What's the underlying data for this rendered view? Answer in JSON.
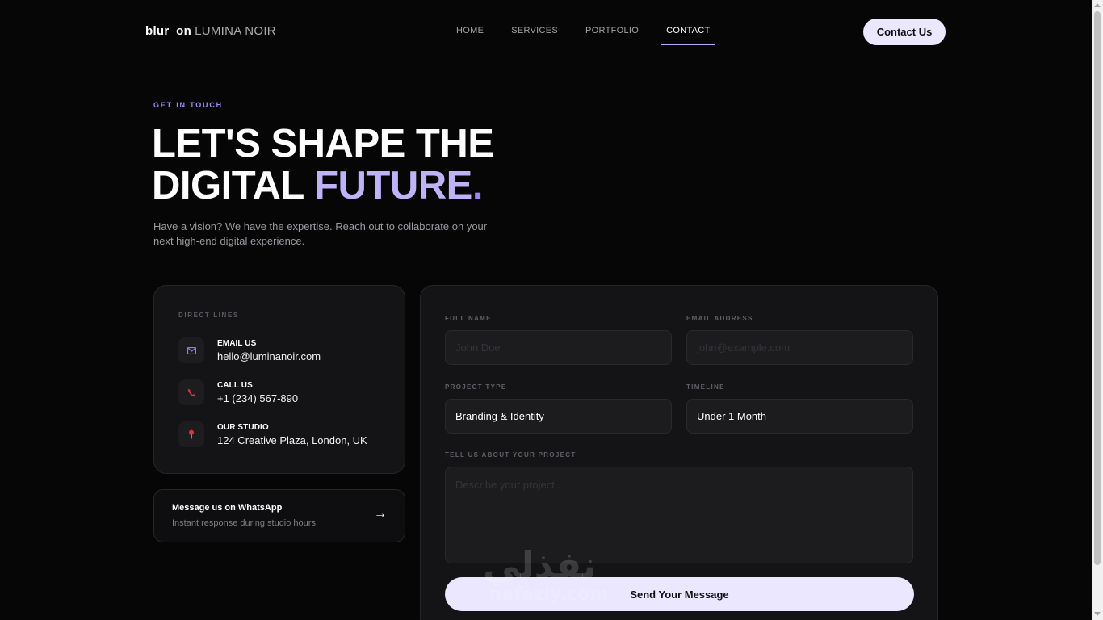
{
  "header": {
    "logo_mark": "blur_on",
    "logo_name": "LUMINA NOIR",
    "nav": [
      {
        "label": "HOME"
      },
      {
        "label": "SERVICES"
      },
      {
        "label": "PORTFOLIO"
      },
      {
        "label": "CONTACT",
        "active": true
      }
    ],
    "cta_label": "Contact Us"
  },
  "hero": {
    "eyebrow": "GET IN TOUCH",
    "headline_line1": "LET'S SHAPE THE",
    "headline_line2_plain": "DIGITAL",
    "headline_line2_accent": "FUTURE",
    "headline_dot": ".",
    "intro": "Have a vision? We have the expertise. Reach out to collaborate on your next high-end digital experience."
  },
  "direct_lines": {
    "title": "DIRECT LINES",
    "items": [
      {
        "icon": "mail-icon",
        "label": "EMAIL US",
        "value": "hello@luminanoir.com",
        "color": "#8b7cf0"
      },
      {
        "icon": "phone-icon",
        "label": "CALL US",
        "value": "+1 (234) 567-890",
        "color": "#e0303a"
      },
      {
        "icon": "pin-icon",
        "label": "OUR STUDIO",
        "value": "124 Creative Plaza, London, UK",
        "color": "#e0303a"
      }
    ]
  },
  "whatsapp": {
    "title": "Message us on WhatsApp",
    "subtitle": "Instant response during studio hours",
    "arrow": "→"
  },
  "form": {
    "full_name_label": "FULL NAME",
    "full_name_placeholder": "John Doe",
    "email_label": "EMAIL ADDRESS",
    "email_placeholder": "john@example.com",
    "project_type_label": "PROJECT TYPE",
    "project_type_value": "Branding & Identity",
    "timeline_label": "TIMELINE",
    "timeline_value": "Under 1 Month",
    "message_label": "TELL US ABOUT YOUR PROJECT",
    "message_placeholder": "Describe your project...",
    "submit_label": "Send Your Message"
  },
  "watermark": {
    "arabic": "نفذلي",
    "latin": "nafezly.com"
  },
  "colors": {
    "accent": "#c0b2f6",
    "eyebrow": "#9e8af4",
    "button_bg": "#ebe7ff",
    "background": "#060607"
  }
}
